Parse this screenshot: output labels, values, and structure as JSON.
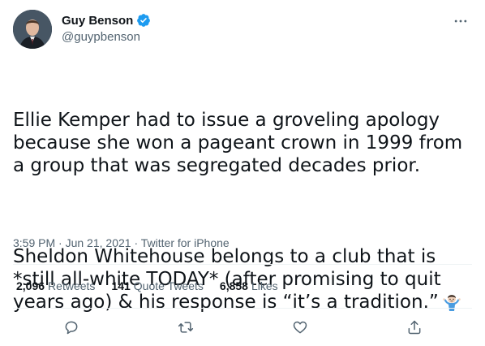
{
  "author": {
    "display_name": "Guy Benson",
    "handle": "@guypbenson",
    "verified": true,
    "verified_color": "#1d9bf0"
  },
  "tweet": {
    "paragraphs": [
      "Ellie Kemper had to issue a groveling apology because she won a pageant crown in 1999 from a group that was segregated decades prior.",
      "Sheldon Whitehouse belongs to a club that is *still all-white TODAY* (after promising to quit years ago) & his response is “it’s a tradition.”"
    ],
    "emoji": "person-shrugging-emoji"
  },
  "meta": {
    "time": "3:59 PM",
    "separator": " · ",
    "date": "Jun 21, 2021",
    "source": "Twitter for iPhone"
  },
  "stats": {
    "retweets": {
      "count": "2,096",
      "label": "Retweets"
    },
    "quotes": {
      "count": "141",
      "label": "Quote Tweets"
    },
    "likes": {
      "count": "6,858",
      "label": "Likes"
    }
  },
  "actions": {
    "icons": [
      "reply-icon",
      "retweet-icon",
      "like-icon",
      "share-icon"
    ]
  },
  "colors": {
    "text": "#0f1419",
    "secondary": "#536471",
    "divider": "#eff3f4"
  }
}
